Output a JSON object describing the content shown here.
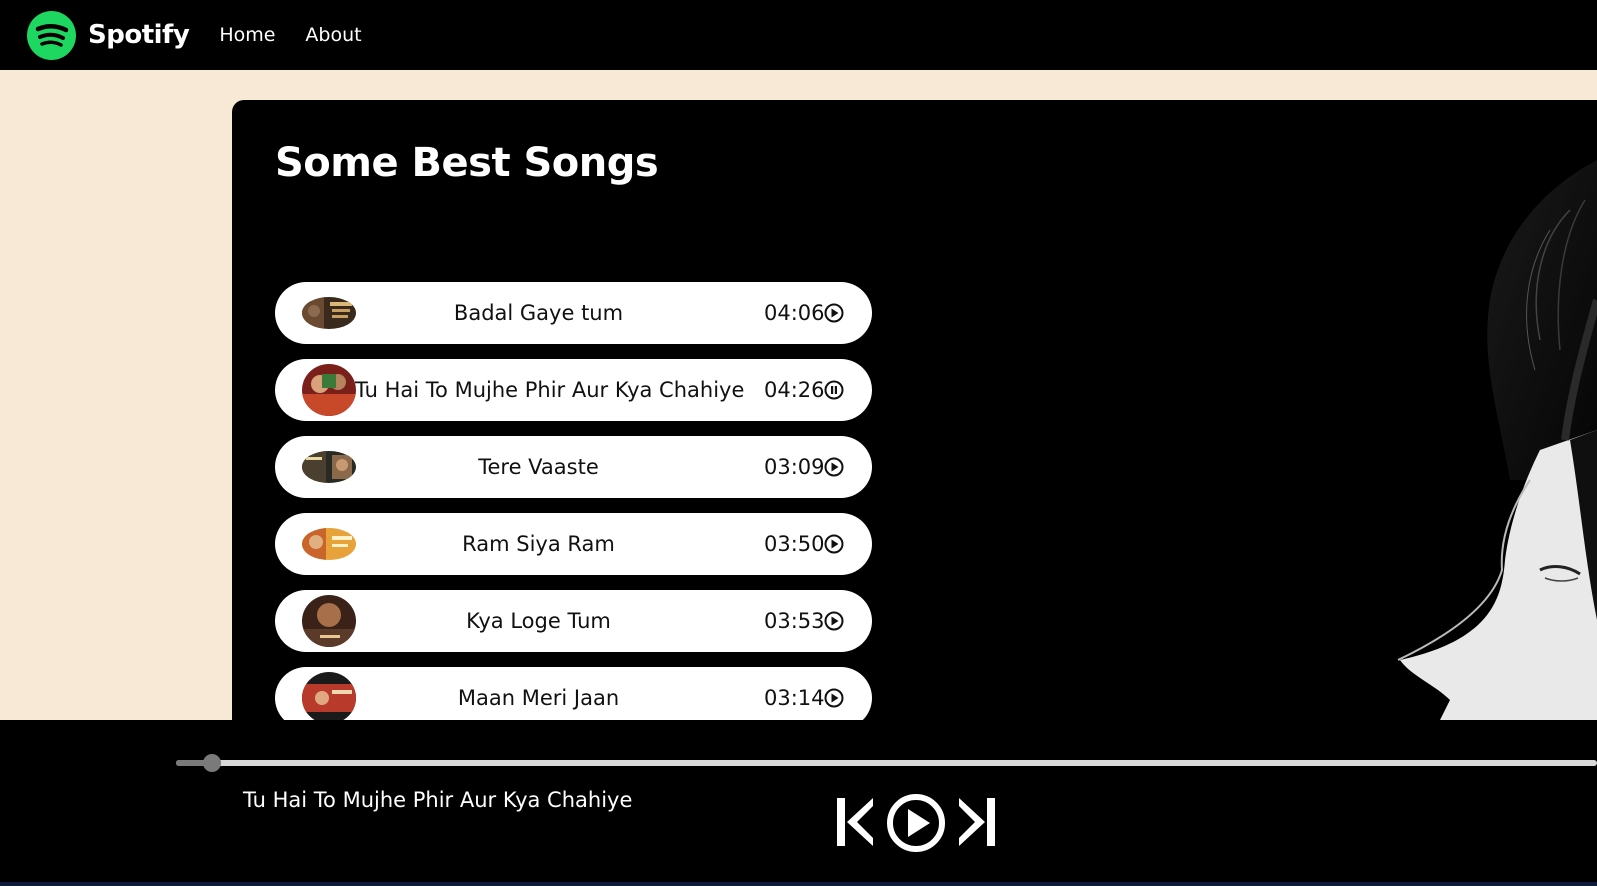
{
  "nav": {
    "brand": "Spotify",
    "links": [
      "Home",
      "About"
    ],
    "logo_icon": "spotify-logo",
    "logo_color": "#1ed760"
  },
  "panel": {
    "title": "Some Best Songs"
  },
  "songs": [
    {
      "name": "Badal Gaye tum",
      "duration": "04:06",
      "state": "play"
    },
    {
      "name": "Tu Hai To Mujhe Phir Aur Kya Chahiye",
      "duration": "04:26",
      "state": "pause"
    },
    {
      "name": "Tere Vaaste",
      "duration": "03:09",
      "state": "play"
    },
    {
      "name": "Ram Siya Ram",
      "duration": "03:50",
      "state": "play"
    },
    {
      "name": "Kya Loge Tum",
      "duration": "03:53",
      "state": "play"
    },
    {
      "name": "Maan Meri Jaan",
      "duration": "03:14",
      "state": "play"
    }
  ],
  "player": {
    "now_playing": "Tu Hai To Mujhe Phir Aur Kya Chahiye",
    "progress_fraction": 0.025,
    "controls": [
      "previous-icon",
      "play-circle-icon",
      "next-icon"
    ]
  },
  "colors": {
    "page_bg": "#f8e9d6",
    "accent": "#1ed760",
    "panel_bg": "#000000"
  }
}
